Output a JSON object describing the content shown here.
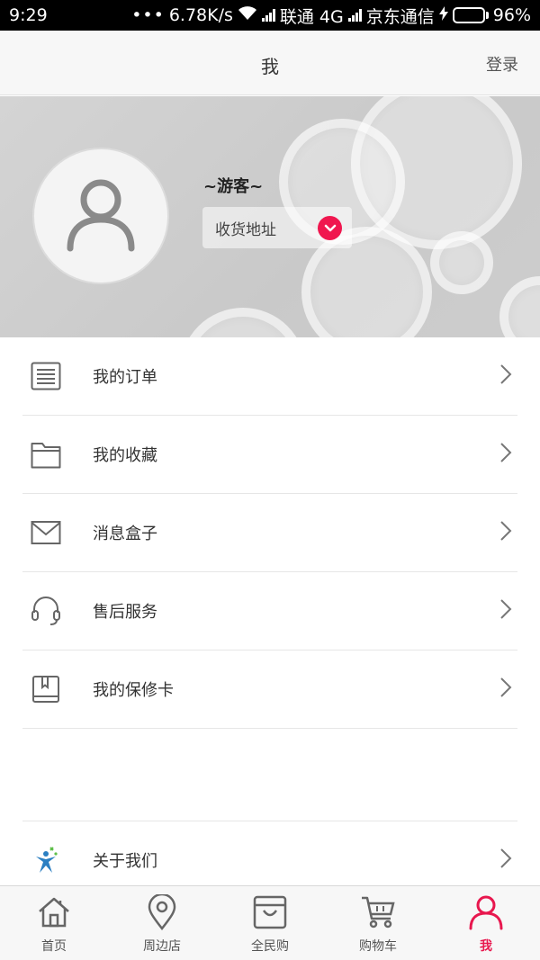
{
  "status_bar": {
    "time": "9:29",
    "speed": "6.78K/s",
    "carrier1": "联通 4G",
    "carrier2": "京东通信",
    "battery": "96%",
    "battery_level": 0.96
  },
  "header": {
    "title": "我",
    "login": "登录"
  },
  "profile": {
    "user_name": "~游客~",
    "address_label": "收货地址"
  },
  "menu": {
    "items": [
      {
        "label": "我的订单",
        "icon": "list-icon"
      },
      {
        "label": "我的收藏",
        "icon": "folder-icon"
      },
      {
        "label": "消息盒子",
        "icon": "mail-icon"
      },
      {
        "label": "售后服务",
        "icon": "headset-icon"
      },
      {
        "label": "我的保修卡",
        "icon": "book-icon"
      }
    ],
    "about": {
      "label": "关于我们",
      "icon": "logo-icon"
    }
  },
  "nav": {
    "items": [
      {
        "label": "首页",
        "icon": "home-icon"
      },
      {
        "label": "周边店",
        "icon": "location-icon"
      },
      {
        "label": "全民购",
        "icon": "bag-icon"
      },
      {
        "label": "购物车",
        "icon": "cart-icon"
      },
      {
        "label": "我",
        "icon": "user-icon"
      }
    ],
    "active_index": 4
  },
  "colors": {
    "accent": "#e8174e",
    "battery_fill": "#3dc93d"
  }
}
